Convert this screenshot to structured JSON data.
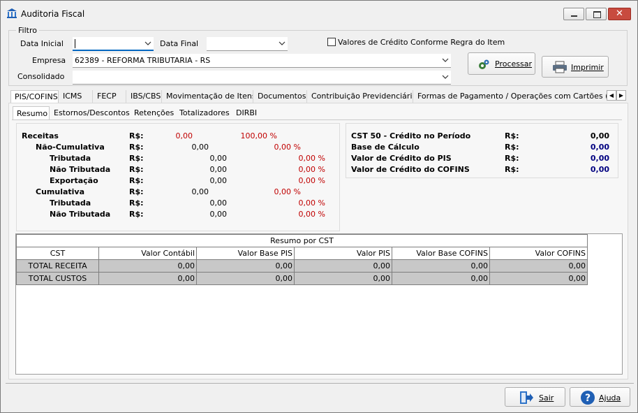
{
  "window": {
    "title": "Auditoria Fiscal",
    "close_label": "✕"
  },
  "filtro": {
    "legend": "Filtro",
    "data_inicial_label": "Data Inicial",
    "data_inicial_value": "",
    "data_final_label": "Data Final",
    "data_final_value": "",
    "checkbox_label": "Valores de Crédito Conforme Regra do Item",
    "checkbox_checked": false,
    "empresa_label": "Empresa",
    "empresa_value": "62389 - REFORMA TRIBUTARIA - RS",
    "consolidado_label": "Consolidado",
    "consolidado_value": ""
  },
  "buttons": {
    "processar": "Processar",
    "imprimir": "Imprimir",
    "sair": "Sair",
    "ajuda": "Ajuda"
  },
  "main_tabs": [
    "PIS/COFINS",
    "ICMS",
    "FECP",
    "IBS/CBS",
    "Movimentação de Itens",
    "Documentos",
    "Contribuição Previdenciária",
    "Formas de Pagamento / Operações com Cartões  (Re"
  ],
  "sub_tabs": [
    "Resumo",
    "Estornos/Descontos",
    "Retenções",
    "Totalizadores",
    "DIRBI"
  ],
  "resumo_left": [
    {
      "label": "Receitas",
      "rs": "R$:",
      "value": "0,00",
      "pct": "100,00 %"
    },
    {
      "label": "Não-Cumulativa",
      "rs": "R$:",
      "value": "0,00",
      "pct": "0,00 %"
    },
    {
      "label": "Tributada",
      "rs": "R$:",
      "value": "0,00",
      "pct": "0,00 %"
    },
    {
      "label": "Não Tributada",
      "rs": "R$:",
      "value": "0,00",
      "pct": "0,00 %"
    },
    {
      "label": "Exportação",
      "rs": "R$:",
      "value": "0,00",
      "pct": "0,00 %"
    },
    {
      "label": "Cumulativa",
      "rs": "R$:",
      "value": "0,00",
      "pct": "0,00 %"
    },
    {
      "label": "Tributada",
      "rs": "R$:",
      "value": "0,00",
      "pct": "0,00 %"
    },
    {
      "label": "Não Tributada",
      "rs": "R$:",
      "value": "0,00",
      "pct": "0,00 %"
    }
  ],
  "resumo_right": [
    {
      "label": "CST 50 - Crédito no Período",
      "rs": "R$:",
      "value": "0,00"
    },
    {
      "label": "Base de Cálculo",
      "rs": "R$:",
      "value": "0,00"
    },
    {
      "label": "Valor de Crédito do PIS",
      "rs": "R$:",
      "value": "0,00"
    },
    {
      "label": "Valor de Crédito do COFINS",
      "rs": "R$:",
      "value": "0,00"
    }
  ],
  "grid": {
    "caption": "Resumo por CST",
    "columns": [
      "CST",
      "Valor Contábil",
      "Valor Base PIS",
      "Valor PIS",
      "Valor Base COFINS",
      "Valor COFINS"
    ],
    "rows": [
      [
        "TOTAL RECEITA",
        "0,00",
        "0,00",
        "0,00",
        "0,00",
        "0,00"
      ],
      [
        "TOTAL CUSTOS",
        "0,00",
        "0,00",
        "0,00",
        "0,00",
        "0,00"
      ]
    ]
  }
}
